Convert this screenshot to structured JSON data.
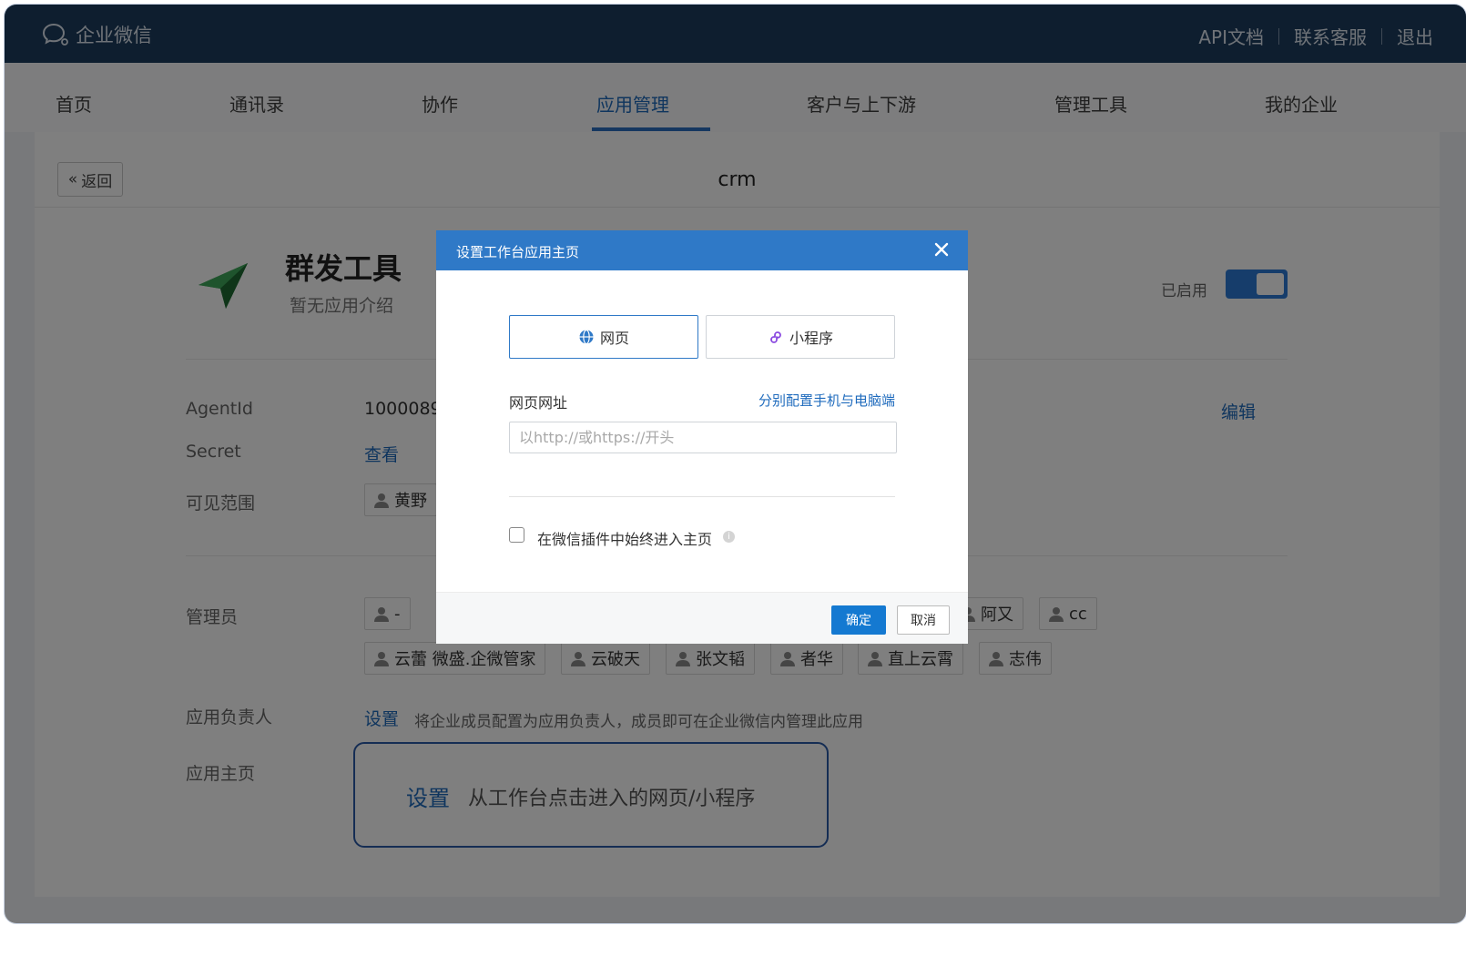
{
  "topbar": {
    "brand": "企业微信",
    "links": [
      "API文档",
      "联系客服",
      "退出"
    ]
  },
  "nav": {
    "items": [
      "首页",
      "通讯录",
      "协作",
      "应用管理",
      "客户与上下游",
      "管理工具",
      "我的企业"
    ],
    "active": "应用管理"
  },
  "page": {
    "back_label": "返回",
    "title": "crm"
  },
  "app": {
    "name": "群发工具",
    "desc": "暂无应用介绍",
    "enabled_label": "已启用",
    "enabled": true,
    "edit_label": "编辑",
    "agentid_label": "AgentId",
    "agentid_value": "1000089",
    "secret_label": "Secret",
    "secret_link": "查看",
    "visible_label": "可见范围",
    "visible_users": [
      "黄野"
    ],
    "admin_label": "管理员",
    "admins_row1": [
      "-",
      "阿又",
      "cc"
    ],
    "admins_row2": [
      "云蕾 微盛.企微管家",
      "云破天",
      "张文韬",
      "者华",
      "直上云霄",
      "志伟"
    ],
    "owner_label": "应用负责人",
    "owner_link": "设置",
    "owner_hint": "将企业成员配置为应用负责人，成员即可在企业微信内管理此应用",
    "home_label": "应用主页",
    "home_link": "设置",
    "home_desc": "从工作台点击进入的网页/小程序"
  },
  "modal": {
    "title": "设置工作台应用主页",
    "tab_web": "网页",
    "tab_miniprogram": "小程序",
    "active_tab": "网页",
    "url_label": "网页网址",
    "split_config_link": "分别配置手机与电脑端",
    "url_placeholder": "以http://或https://开头",
    "url_value": "",
    "checkbox_label": "在微信插件中始终进入主页",
    "checkbox_checked": false,
    "ok_label": "确定",
    "cancel_label": "取消"
  },
  "colors": {
    "topbar": "#1c3c5e",
    "accent": "#2f79c7",
    "link": "#1f6bbd"
  }
}
